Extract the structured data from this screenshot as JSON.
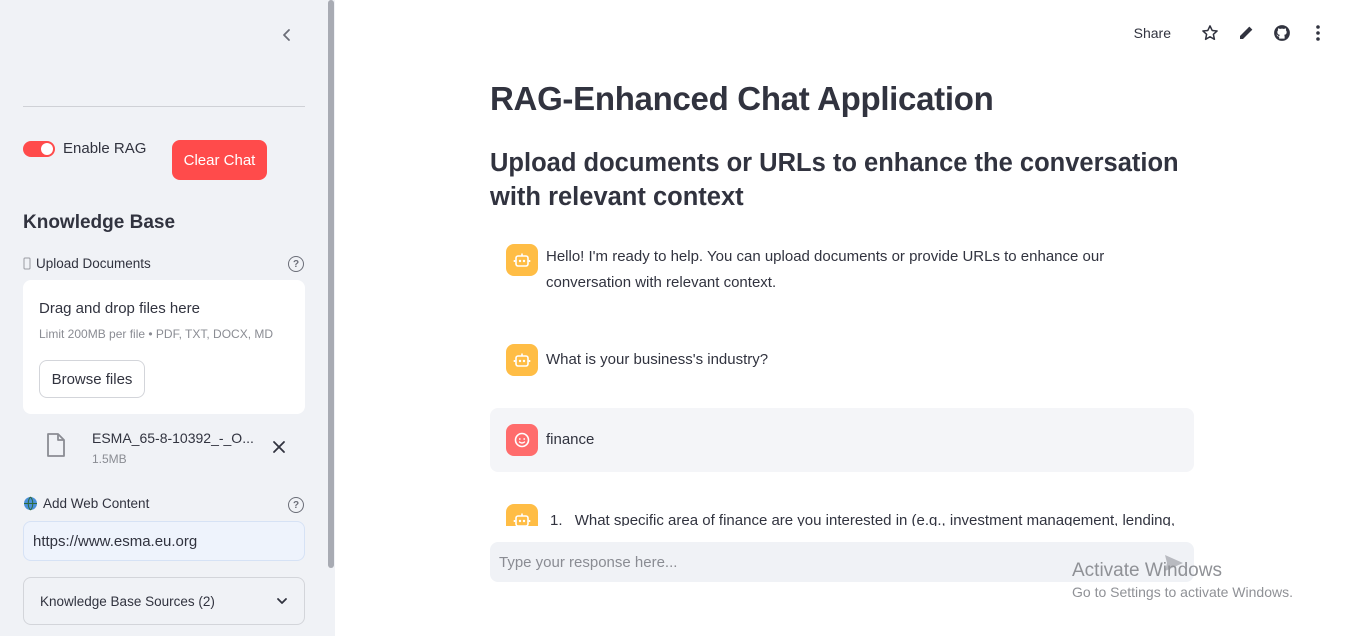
{
  "sidebar": {
    "enable_rag_label": "Enable RAG",
    "enable_rag_on": true,
    "clear_chat_label": "Clear Chat",
    "knowledge_base_title": "Knowledge Base",
    "upload": {
      "label": "Upload Documents",
      "help": "?",
      "dropzone_title": "Drag and drop files here",
      "dropzone_limit": "Limit 200MB per file • PDF, TXT, DOCX, MD",
      "browse_label": "Browse files",
      "file": {
        "name": "ESMA_65-8-10392_-_O...",
        "size": "1.5MB"
      }
    },
    "web": {
      "label": "Add Web Content",
      "help": "?",
      "url_value": "https://www.esma.eu.org"
    },
    "sources_label": "Knowledge Base Sources (2)"
  },
  "header": {
    "share_label": "Share",
    "icons": [
      "star-icon",
      "edit-icon",
      "github-icon",
      "more-vertical-icon"
    ]
  },
  "main": {
    "title": "RAG-Enhanced Chat Application",
    "subtitle": "Upload documents or URLs to enhance the conversation with relevant context",
    "messages": [
      {
        "role": "assistant",
        "text": "Hello! I'm ready to help. You can upload documents or provide URLs to enhance our conversation with relevant context."
      },
      {
        "role": "assistant",
        "text": "What is your business's industry?"
      },
      {
        "role": "user",
        "text": "finance"
      },
      {
        "role": "assistant",
        "list_number": "1.",
        "text": "What specific area of finance are you interested in (e.g., investment management, lending,"
      }
    ],
    "input_placeholder": "Type your response here..."
  },
  "watermark": {
    "title": "Activate Windows",
    "subtitle": "Go to Settings to activate Windows."
  },
  "colors": {
    "accent": "#ff4b4b",
    "sidebar_bg": "#f0f2f6",
    "bot_avatar": "#ffbd45",
    "user_avatar": "#ff6c6c"
  }
}
